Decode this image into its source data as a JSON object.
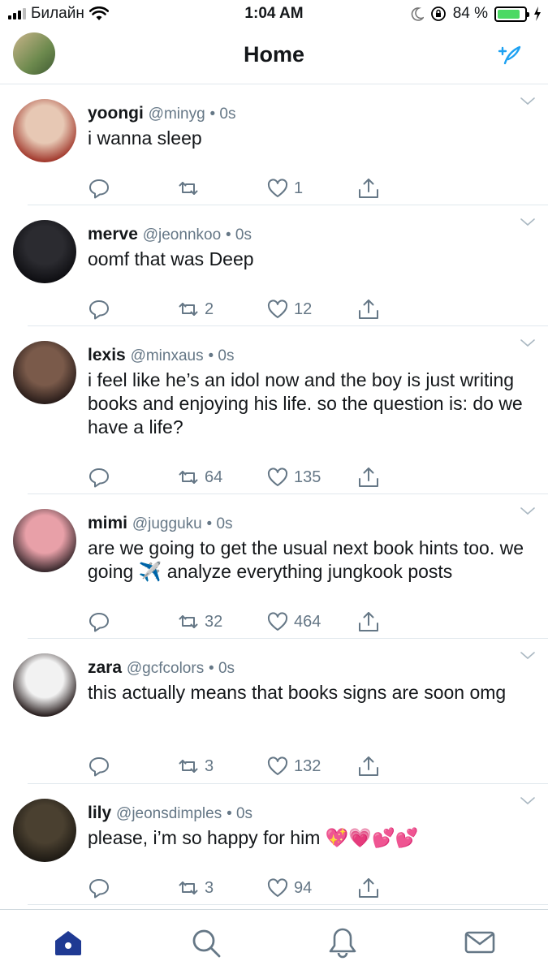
{
  "status_bar": {
    "carrier": "Билайн",
    "time": "1:04 AM",
    "battery_percent": "84 %",
    "battery_level": 0.84,
    "icons": [
      "signal-icon",
      "wifi-icon",
      "moon-icon",
      "orientation-lock-icon",
      "battery-icon",
      "charging-icon"
    ]
  },
  "header": {
    "title": "Home",
    "icons": [
      "profile-avatar",
      "compose-icon"
    ]
  },
  "accent_color": "#1da1f2",
  "tweets": [
    {
      "name": "yoongi",
      "handle": "@minyg",
      "time": "• 0s",
      "text": "i wanna sleep",
      "retweets": "",
      "likes": "1",
      "avatar_colors": [
        "#e7c8b4",
        "#a23a2e"
      ]
    },
    {
      "name": "merve",
      "handle": "@jeonnkoo",
      "time": "• 0s",
      "text": "oomf that was Deep",
      "retweets": "2",
      "likes": "12",
      "avatar_colors": [
        "#2b2b30",
        "#0e0e12"
      ]
    },
    {
      "name": "lexis",
      "handle": "@minxaus",
      "time": "• 0s",
      "text": "i feel like he’s an idol now and the boy is just writing books and enjoying his life. so the question is: do we have a life?",
      "retweets": "64",
      "likes": "135",
      "avatar_colors": [
        "#7a5a4a",
        "#2a1d1a"
      ]
    },
    {
      "name": "mimi",
      "handle": "@jugguku",
      "time": "• 0s",
      "text": "are we going to get the usual next book hints too. we going ✈️ analyze everything jungkook posts",
      "retweets": "32",
      "likes": "464",
      "avatar_colors": [
        "#e8a0a8",
        "#3a2a2e"
      ]
    },
    {
      "name": "zara",
      "handle": "@gcfcolors",
      "time": "• 0s",
      "text": "this actually means that books signs are soon omg",
      "retweets": "3",
      "likes": "132",
      "avatar_colors": [
        "#f2f2f2",
        "#2a2020"
      ]
    },
    {
      "name": "lily",
      "handle": "@jeonsdimples",
      "time": "• 0s",
      "text": "please, i’m so happy for him 💖💗💕💕",
      "retweets": "3",
      "likes": "94",
      "avatar_colors": [
        "#4a4030",
        "#1e1a14"
      ]
    }
  ],
  "tab_bar": {
    "icons": [
      "home-icon",
      "search-icon",
      "notifications-icon",
      "messages-icon"
    ],
    "active_color": "#1f3a93",
    "inactive_color": "#657786"
  }
}
